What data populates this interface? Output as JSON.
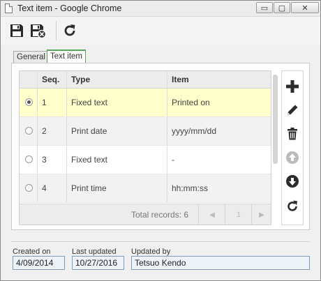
{
  "window": {
    "title": "Text item - Google Chrome",
    "minimize_glyph": "▭",
    "maximize_glyph": "▢",
    "close_glyph": "✕"
  },
  "toolbar": {
    "icons": [
      "save-icon",
      "save-and-close-icon",
      "refresh-icon"
    ]
  },
  "tabs": [
    {
      "label": "General",
      "active": false
    },
    {
      "label": "Text item",
      "active": true
    }
  ],
  "grid": {
    "columns": [
      "",
      "Seq.",
      "Type",
      "Item"
    ],
    "rows": [
      {
        "selected": true,
        "seq": "1",
        "type": "Fixed text",
        "item": "Printed on"
      },
      {
        "selected": false,
        "seq": "2",
        "type": "Print date",
        "item": "yyyy/mm/dd"
      },
      {
        "selected": false,
        "seq": "3",
        "type": "Fixed text",
        "item": "-"
      },
      {
        "selected": false,
        "seq": "4",
        "type": "Print time",
        "item": "hh:mm:ss"
      }
    ],
    "total_records": "Total records: 6",
    "page": "1",
    "prev_glyph": "◀",
    "next_glyph": "▶"
  },
  "side_actions": [
    "add-icon",
    "edit-icon",
    "delete-icon",
    "move-up-icon",
    "move-down-icon",
    "refresh-icon"
  ],
  "colors": {
    "selected_row": "#ffffcc",
    "active_tab_border": "#5aa35a",
    "icon": "#333333",
    "disabled_icon": "#bbbbbb"
  },
  "footer": {
    "created_on": {
      "label": "Created on",
      "value": "4/09/2014"
    },
    "last_updated": {
      "label": "Last updated",
      "value": "10/27/2016"
    },
    "updated_by": {
      "label": "Updated by",
      "value": "Tetsuo Kendo"
    }
  }
}
